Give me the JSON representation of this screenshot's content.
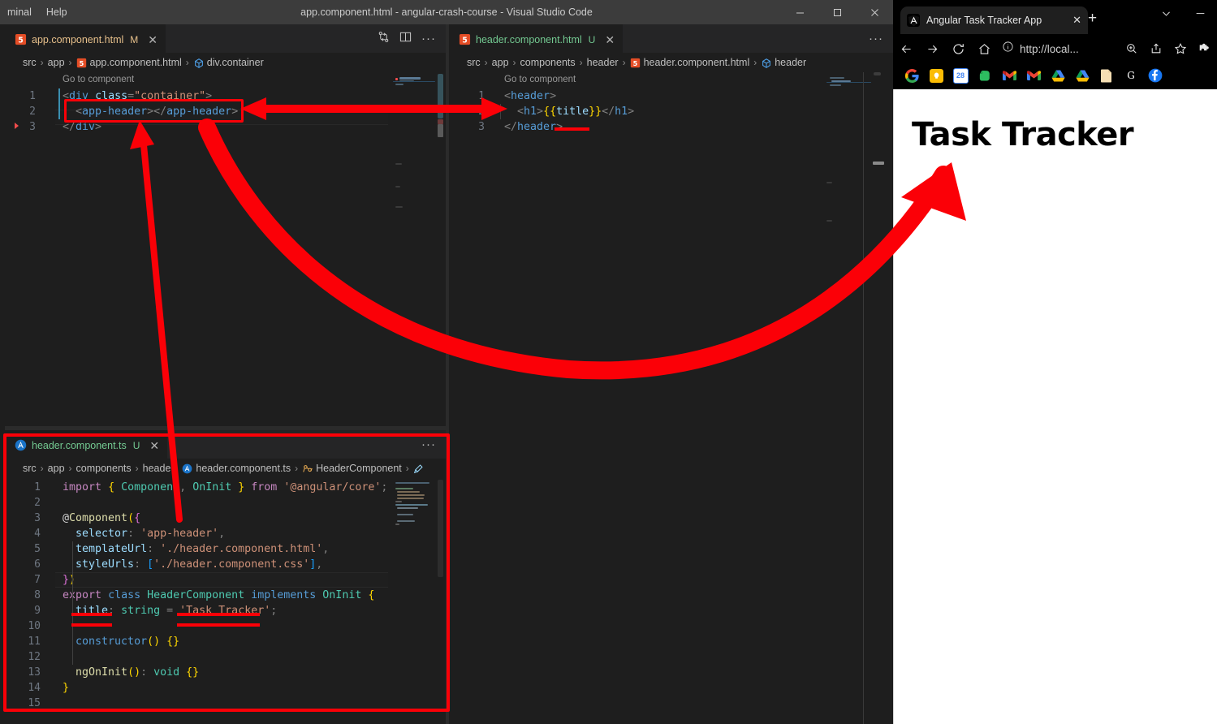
{
  "vscode": {
    "menu": [
      "minal",
      "Help"
    ],
    "window_title": "app.component.html - angular-crash-course - Visual Studio Code",
    "window_controls": {
      "minimize": "minimize-icon",
      "maximize": "maximize-icon",
      "close": "close-icon"
    },
    "panes": {
      "left": {
        "tab": {
          "label": "app.component.html",
          "badge": "M",
          "icon": "html5-icon",
          "close": "✕"
        },
        "actions": {
          "split_changes": "compare-changes-icon",
          "split_editor": "split-editor-icon",
          "more": "···"
        },
        "breadcrumb": [
          "src",
          "app",
          "app.component.html",
          "div.container"
        ],
        "codelens": "Go to component",
        "lines": [
          {
            "n": "1",
            "tokens": [
              [
                "t-punct",
                "<"
              ],
              [
                "t-tag",
                "div"
              ],
              [
                "t-plain",
                " "
              ],
              [
                "t-attr",
                "class"
              ],
              [
                "t-punct",
                "="
              ],
              [
                "t-str",
                "\"container\""
              ],
              [
                "t-punct",
                ">"
              ]
            ]
          },
          {
            "n": "2",
            "tokens": [
              [
                "t-plain",
                "  "
              ],
              [
                "t-punct",
                "<"
              ],
              [
                "t-tag",
                "app-header"
              ],
              [
                "t-punct",
                "></"
              ],
              [
                "t-tag",
                "app-header"
              ],
              [
                "t-punct",
                ">"
              ]
            ]
          },
          {
            "n": "3",
            "tokens": [
              [
                "t-punct",
                "</"
              ],
              [
                "t-tag",
                "div"
              ],
              [
                "t-punct",
                ">"
              ]
            ]
          }
        ]
      },
      "right": {
        "tab": {
          "label": "header.component.html",
          "badge": "U",
          "icon": "html5-icon",
          "close": "✕"
        },
        "actions": {
          "more": "···"
        },
        "breadcrumb": [
          "src",
          "app",
          "components",
          "header",
          "header.component.html",
          "header"
        ],
        "codelens": "Go to component",
        "lines": [
          {
            "n": "1",
            "tokens": [
              [
                "t-punct",
                "<"
              ],
              [
                "t-tag",
                "header"
              ],
              [
                "t-punct",
                ">"
              ]
            ]
          },
          {
            "n": "2",
            "tokens": [
              [
                "t-plain",
                "  "
              ],
              [
                "t-punct",
                "<"
              ],
              [
                "t-tag",
                "h1"
              ],
              [
                "t-punct",
                ">"
              ],
              [
                "t-brace1",
                "{{"
              ],
              [
                "t-attr",
                "title"
              ],
              [
                "t-brace1",
                "}}"
              ],
              [
                "t-punct",
                "</"
              ],
              [
                "t-tag",
                "h1"
              ],
              [
                "t-punct",
                ">"
              ]
            ]
          },
          {
            "n": "3",
            "tokens": [
              [
                "t-punct",
                "</"
              ],
              [
                "t-tag",
                "header"
              ],
              [
                "t-punct",
                ">"
              ]
            ]
          }
        ]
      },
      "bottom": {
        "tab": {
          "label": "header.component.ts",
          "badge": "U",
          "icon": "angular-icon",
          "close": "✕"
        },
        "actions": {
          "more": "···"
        },
        "breadcrumb": [
          "src",
          "app",
          "components",
          "heade",
          "header.component.ts",
          "HeaderComponent"
        ],
        "lines": [
          {
            "n": "1",
            "tokens": [
              [
                "t-kw",
                "import"
              ],
              [
                "t-plain",
                " "
              ],
              [
                "t-brace1",
                "{"
              ],
              [
                "t-plain",
                " "
              ],
              [
                "t-type",
                "Component"
              ],
              [
                "t-punct",
                ","
              ],
              [
                "t-plain",
                " "
              ],
              [
                "t-type",
                "OnInit"
              ],
              [
                "t-plain",
                " "
              ],
              [
                "t-brace1",
                "}"
              ],
              [
                "t-plain",
                " "
              ],
              [
                "t-kw",
                "from"
              ],
              [
                "t-plain",
                " "
              ],
              [
                "t-str",
                "'@angular/core'"
              ],
              [
                "t-punct",
                ";"
              ]
            ]
          },
          {
            "n": "2",
            "tokens": []
          },
          {
            "n": "3",
            "tokens": [
              [
                "t-plain",
                "@"
              ],
              [
                "t-fn",
                "Component"
              ],
              [
                "t-brace1",
                "("
              ],
              [
                "t-brace2",
                "{"
              ]
            ]
          },
          {
            "n": "4",
            "tokens": [
              [
                "t-plain",
                "  "
              ],
              [
                "t-var",
                "selector"
              ],
              [
                "t-punct",
                ": "
              ],
              [
                "t-str",
                "'app-header'"
              ],
              [
                "t-punct",
                ","
              ]
            ]
          },
          {
            "n": "5",
            "tokens": [
              [
                "t-plain",
                "  "
              ],
              [
                "t-var",
                "templateUrl"
              ],
              [
                "t-punct",
                ": "
              ],
              [
                "t-str",
                "'./header.component.html'"
              ],
              [
                "t-punct",
                ","
              ]
            ]
          },
          {
            "n": "6",
            "tokens": [
              [
                "t-plain",
                "  "
              ],
              [
                "t-var",
                "styleUrls"
              ],
              [
                "t-punct",
                ": "
              ],
              [
                "t-brace3",
                "["
              ],
              [
                "t-str",
                "'./header.component.css'"
              ],
              [
                "t-brace3",
                "]"
              ],
              [
                "t-punct",
                ","
              ]
            ]
          },
          {
            "n": "7",
            "tokens": [
              [
                "t-brace2",
                "}"
              ],
              [
                "t-brace1",
                ")"
              ]
            ]
          },
          {
            "n": "8",
            "tokens": [
              [
                "t-kw",
                "export"
              ],
              [
                "t-plain",
                " "
              ],
              [
                "t-kw2",
                "class"
              ],
              [
                "t-plain",
                " "
              ],
              [
                "t-type",
                "HeaderComponent"
              ],
              [
                "t-plain",
                " "
              ],
              [
                "t-kw2",
                "implements"
              ],
              [
                "t-plain",
                " "
              ],
              [
                "t-type",
                "OnInit"
              ],
              [
                "t-plain",
                " "
              ],
              [
                "t-brace1",
                "{"
              ]
            ]
          },
          {
            "n": "9",
            "tokens": [
              [
                "t-plain",
                "  "
              ],
              [
                "t-var",
                "title"
              ],
              [
                "t-punct",
                ": "
              ],
              [
                "t-type",
                "string"
              ],
              [
                "t-plain",
                " "
              ],
              [
                "t-punct",
                "= "
              ],
              [
                "t-str",
                "'Task Tracker'"
              ],
              [
                "t-punct",
                ";"
              ]
            ]
          },
          {
            "n": "10",
            "tokens": []
          },
          {
            "n": "11",
            "tokens": [
              [
                "t-plain",
                "  "
              ],
              [
                "t-kw2",
                "constructor"
              ],
              [
                "t-brace1",
                "()"
              ],
              [
                "t-plain",
                " "
              ],
              [
                "t-brace1",
                "{}"
              ]
            ]
          },
          {
            "n": "12",
            "tokens": []
          },
          {
            "n": "13",
            "tokens": [
              [
                "t-plain",
                "  "
              ],
              [
                "t-fn",
                "ngOnInit"
              ],
              [
                "t-brace1",
                "()"
              ],
              [
                "t-punct",
                ": "
              ],
              [
                "t-type",
                "void"
              ],
              [
                "t-plain",
                " "
              ],
              [
                "t-brace1",
                "{}"
              ]
            ]
          },
          {
            "n": "14",
            "tokens": [
              [
                "t-brace1",
                "}"
              ]
            ]
          },
          {
            "n": "15",
            "tokens": []
          }
        ]
      }
    }
  },
  "browser": {
    "tab": {
      "title": "Angular Task Tracker App",
      "favicon": "angular-icon",
      "close": "✕"
    },
    "new_tab": "+",
    "window_controls": {
      "tab_search": "chevron-down-icon",
      "minimize": "minimize-icon"
    },
    "toolbar": {
      "back": "back-arrow-icon",
      "forward": "forward-arrow-icon",
      "reload": "reload-icon",
      "home": "home-icon",
      "info": "info-circle-icon",
      "url": "http://local...",
      "zoom": "zoom-icon",
      "share": "share-icon",
      "bookmark": "star-icon",
      "extensions": "puzzle-icon"
    },
    "bookmarks": [
      {
        "name": "google-bookmark",
        "label": "G"
      },
      {
        "name": "keep-bookmark",
        "label": ""
      },
      {
        "name": "calendar-bookmark",
        "label": "28"
      },
      {
        "name": "evernote-bookmark",
        "label": ""
      },
      {
        "name": "gmail-bookmark-1",
        "label": "M"
      },
      {
        "name": "gmail-bookmark-2",
        "label": "M"
      },
      {
        "name": "drive-bookmark-1",
        "label": ""
      },
      {
        "name": "drive-bookmark-2",
        "label": ""
      },
      {
        "name": "docs-bookmark",
        "label": ""
      },
      {
        "name": "g-bookmark",
        "label": "G"
      },
      {
        "name": "facebook-bookmark",
        "label": "f"
      }
    ],
    "overflow": "»",
    "page": {
      "heading": "Task Tracker"
    }
  },
  "annotations": {
    "color": "#fb0007",
    "box_app_header": "highlight-box-app-header",
    "box_header_ts": "highlight-box-header-component-ts",
    "arrow_double": "double-arrow-html-to-html",
    "arrow_to_selector": "arrow-selector-to-app-header",
    "arrow_curved": "curved-arrow-to-browser-title",
    "underline_header": "underline-header-close-tag",
    "underline_title": "underline-title-property",
    "underline_task_tracker": "underline-task-tracker-value"
  }
}
